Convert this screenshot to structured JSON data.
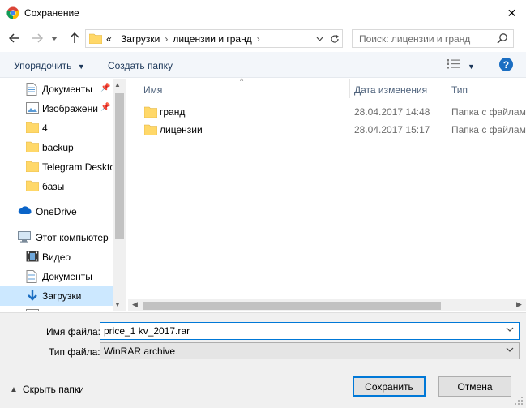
{
  "window": {
    "title": "Сохранение",
    "close_glyph": "✕"
  },
  "address": {
    "overflow_glyph": "«",
    "segments": [
      "Загрузки",
      "лицензии и гранд"
    ],
    "separator": "›"
  },
  "search": {
    "placeholder": "Поиск: лицензии и гранд"
  },
  "toolbar": {
    "organize_label": "Упорядочить",
    "new_folder_label": "Создать папку",
    "help_label": "?"
  },
  "navpane": {
    "items": [
      {
        "label": "Документы",
        "icon": "documents-icon",
        "pinned": true
      },
      {
        "label": "Изображени",
        "icon": "pictures-icon",
        "pinned": true
      },
      {
        "label": "4",
        "icon": "folder-icon"
      },
      {
        "label": "backup",
        "icon": "folder-icon"
      },
      {
        "label": "Telegram Deskto",
        "icon": "folder-icon"
      },
      {
        "label": "базы",
        "icon": "folder-icon"
      },
      {
        "label": "OneDrive",
        "icon": "onedrive-icon"
      },
      {
        "label": "Этот компьютер",
        "icon": "computer-icon"
      },
      {
        "label": "Видео",
        "icon": "video-icon"
      },
      {
        "label": "Документы",
        "icon": "documents-icon"
      },
      {
        "label": "Загрузки",
        "icon": "downloads-icon",
        "selected": true
      }
    ]
  },
  "filelist": {
    "columns": {
      "name": "Имя",
      "date": "Дата изменения",
      "type": "Тип"
    },
    "rows": [
      {
        "name": "гранд",
        "date": "28.04.2017 14:48",
        "type": "Папка с файлами"
      },
      {
        "name": "лицензии",
        "date": "28.04.2017 15:17",
        "type": "Папка с файлами"
      }
    ]
  },
  "form": {
    "filename_label": "Имя файла:",
    "filename_value": "price_1 kv_2017.rar",
    "filetype_label": "Тип файла:",
    "filetype_value": "WinRAR archive"
  },
  "footer": {
    "hide_folders_label": "Скрыть папки",
    "save_label": "Сохранить",
    "cancel_label": "Отмена"
  },
  "colors": {
    "accent": "#0078d7",
    "selection": "#cce8ff",
    "folder": "#ffd869",
    "help": "#1b6ec2"
  }
}
